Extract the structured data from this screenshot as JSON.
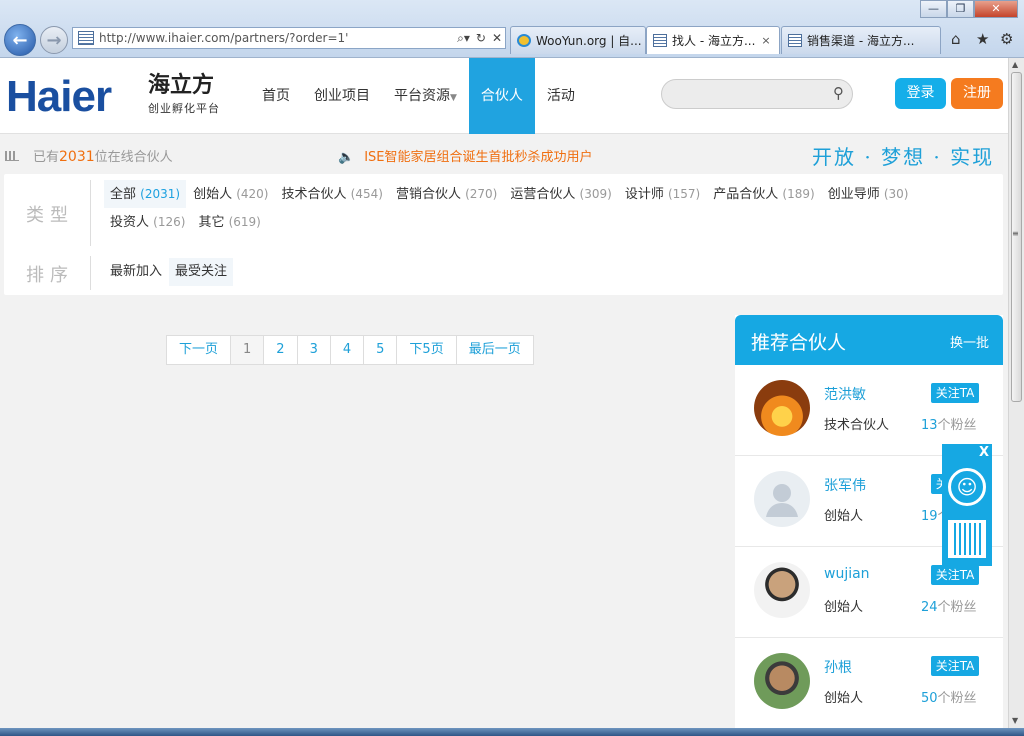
{
  "browser": {
    "url": "http://www.ihaier.com/partners/?order=1'",
    "tabs": [
      {
        "label": "WooYun.org | 自..."
      },
      {
        "label": "找人 - 海立方...",
        "close": "×"
      },
      {
        "label": "销售渠道 - 海立方..."
      }
    ],
    "win_min": "—",
    "win_max": "❐",
    "win_close": "✕"
  },
  "header": {
    "logo_text": "Haier",
    "brand_cn": "海立方",
    "brand_sub": "创业孵化平台",
    "nav": [
      "首页",
      "创业项目",
      "平台资源",
      "合伙人",
      "活动"
    ],
    "nav_active_index": 3,
    "login": "登录",
    "register": "注册"
  },
  "status": {
    "online_prefix": "已有",
    "online_count": "2031",
    "online_suffix": "位在线合伙人",
    "news": "ISE智能家居组合诞生首批秒杀成功用户",
    "slogan": "开放 · 梦想 · 实现"
  },
  "filter": {
    "type_label": "类型",
    "sort_label": "排序",
    "types": [
      {
        "name": "全部",
        "count": "(2031)"
      },
      {
        "name": "创始人",
        "count": "(420)"
      },
      {
        "name": "技术合伙人",
        "count": "(454)"
      },
      {
        "name": "营销合伙人",
        "count": "(270)"
      },
      {
        "name": "运营合伙人",
        "count": "(309)"
      },
      {
        "name": "设计师",
        "count": "(157)"
      },
      {
        "name": "产品合伙人",
        "count": "(189)"
      },
      {
        "name": "创业导师",
        "count": "(30)"
      },
      {
        "name": "投资人",
        "count": "(126)"
      },
      {
        "name": "其它",
        "count": "(619)"
      }
    ],
    "sorts": [
      "最新加入",
      "最受关注"
    ]
  },
  "pager": [
    "下一页",
    "1",
    "2",
    "3",
    "4",
    "5",
    "下5页",
    "最后一页"
  ],
  "recommend": {
    "title": "推荐合伙人",
    "swap": "换一批",
    "follow_label": "关注TA",
    "fans_suffix": "个粉丝",
    "people": [
      {
        "name": "范洪敏",
        "role": "技术合伙人",
        "fans": "13"
      },
      {
        "name": "张军伟",
        "role": "创始人",
        "fans": "19"
      },
      {
        "name": "wujian",
        "role": "创始人",
        "fans": "24"
      },
      {
        "name": "孙根",
        "role": "创始人",
        "fans": "50"
      }
    ]
  },
  "float_widget": {
    "close": "X"
  },
  "colors": {
    "accent": "#16a8e3",
    "orange": "#f57b1f",
    "brand": "#1a4fa0"
  }
}
